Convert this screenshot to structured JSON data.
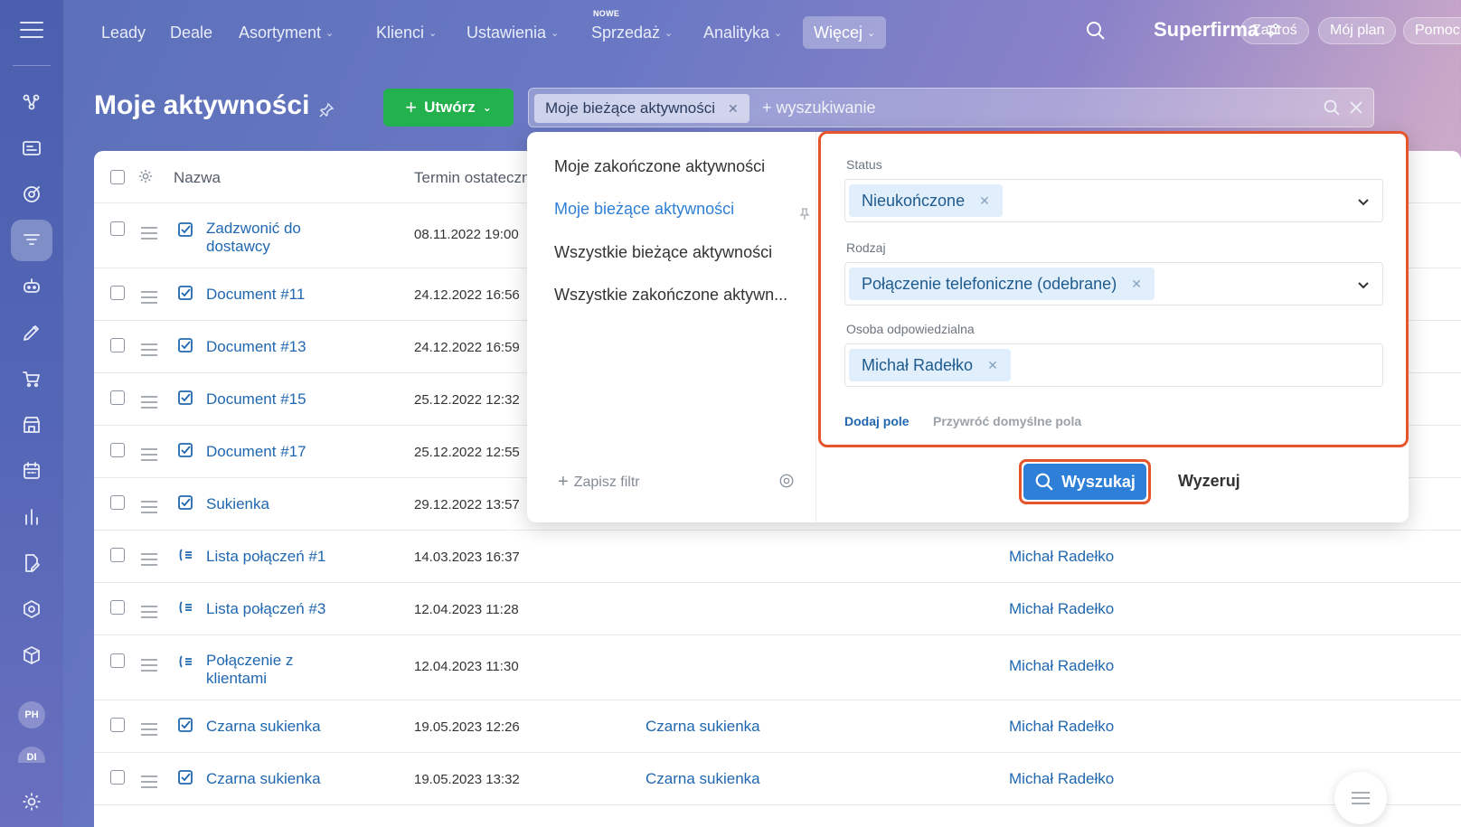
{
  "nav": {
    "items": [
      {
        "label": "Leady",
        "chevron": false
      },
      {
        "label": "Deale",
        "chevron": false
      },
      {
        "label": "Asortyment",
        "chevron": true
      },
      {
        "label": "Klienci",
        "chevron": true
      },
      {
        "label": "Ustawienia",
        "chevron": true
      },
      {
        "label": "Sprzedaż",
        "chevron": true
      },
      {
        "label": "Analityka",
        "chevron": true
      },
      {
        "label": "Więcej",
        "chevron": true
      }
    ],
    "new_badge": "NOWE",
    "brand": "Superfirma",
    "invite": "Zaproś",
    "plan": "Mój plan",
    "help": "Pomoc"
  },
  "sidebar": {
    "icons": [
      "pipeline-icon",
      "contact-card-icon",
      "target-icon",
      "filter-funnel-icon",
      "robot-icon",
      "pen-icon",
      "cart-icon",
      "store-icon",
      "calendar-icon",
      "bar-chart-icon",
      "document-edit-icon",
      "hexagon-icon",
      "cube-icon"
    ],
    "active_index": 3,
    "avatars": [
      "PH",
      "DI"
    ]
  },
  "header": {
    "title": "Moje aktywności",
    "create_label": "Utwórz"
  },
  "search": {
    "tag": "Moje bieżące aktywności",
    "placeholder": "+ wyszukiwanie"
  },
  "grid": {
    "columns": {
      "name": "Nazwa",
      "deadline": "Termin ostateczn"
    },
    "rows": [
      {
        "icon": "task",
        "name": "Zadzwonić do dostawcy",
        "date": "08.11.2022 19:00",
        "item": "",
        "person": ""
      },
      {
        "icon": "task",
        "name": "Document #11",
        "date": "24.12.2022 16:56",
        "item": "",
        "person": ""
      },
      {
        "icon": "task",
        "name": "Document #13",
        "date": "24.12.2022 16:59",
        "item": "",
        "person": ""
      },
      {
        "icon": "task",
        "name": "Document #15",
        "date": "25.12.2022 12:32",
        "item": "",
        "person": ""
      },
      {
        "icon": "task",
        "name": "Document #17",
        "date": "25.12.2022 12:55",
        "item": "",
        "person": ""
      },
      {
        "icon": "task",
        "name": "Sukienka",
        "date": "29.12.2022 13:57",
        "item": "",
        "person": ""
      },
      {
        "icon": "call",
        "name": "Lista połączeń #1",
        "date": "14.03.2023 16:37",
        "item": "",
        "person": "Michał Radełko"
      },
      {
        "icon": "call",
        "name": "Lista połączeń #3",
        "date": "12.04.2023 11:28",
        "item": "",
        "person": "Michał Radełko"
      },
      {
        "icon": "call",
        "name": "Połączenie z klientami",
        "date": "12.04.2023 11:30",
        "item": "",
        "person": "Michał Radełko"
      },
      {
        "icon": "task",
        "name": "Czarna sukienka",
        "date": "19.05.2023 12:26",
        "item": "Czarna sukienka",
        "person": "Michał Radełko"
      },
      {
        "icon": "task",
        "name": "Czarna sukienka",
        "date": "19.05.2023 13:32",
        "item": "Czarna sukienka",
        "person": "Michał Radełko"
      }
    ]
  },
  "filter": {
    "presets": [
      "Moje zakończone aktywności",
      "Moje bieżące aktywności",
      "Wszystkie bieżące aktywności",
      "Wszystkie zakończone aktywn..."
    ],
    "active_preset": 1,
    "save_filter": "Zapisz filtr",
    "fields": [
      {
        "label": "Status",
        "value": "Nieukończone",
        "dropdown": true
      },
      {
        "label": "Rodzaj",
        "value": "Połączenie telefoniczne (odebrane)",
        "dropdown": true
      },
      {
        "label": "Osoba odpowiedzialna",
        "value": "Michał Radełko",
        "dropdown": false
      }
    ],
    "add_field": "Dodaj pole",
    "restore_fields": "Przywróć domyślne pola",
    "search_button": "Wyszukaj",
    "reset_button": "Wyzeruj"
  },
  "colors": {
    "accent": "#2d7fd8",
    "create_green": "#22b14c",
    "highlight_red": "#e5542a",
    "link_blue": "#2067b0"
  }
}
